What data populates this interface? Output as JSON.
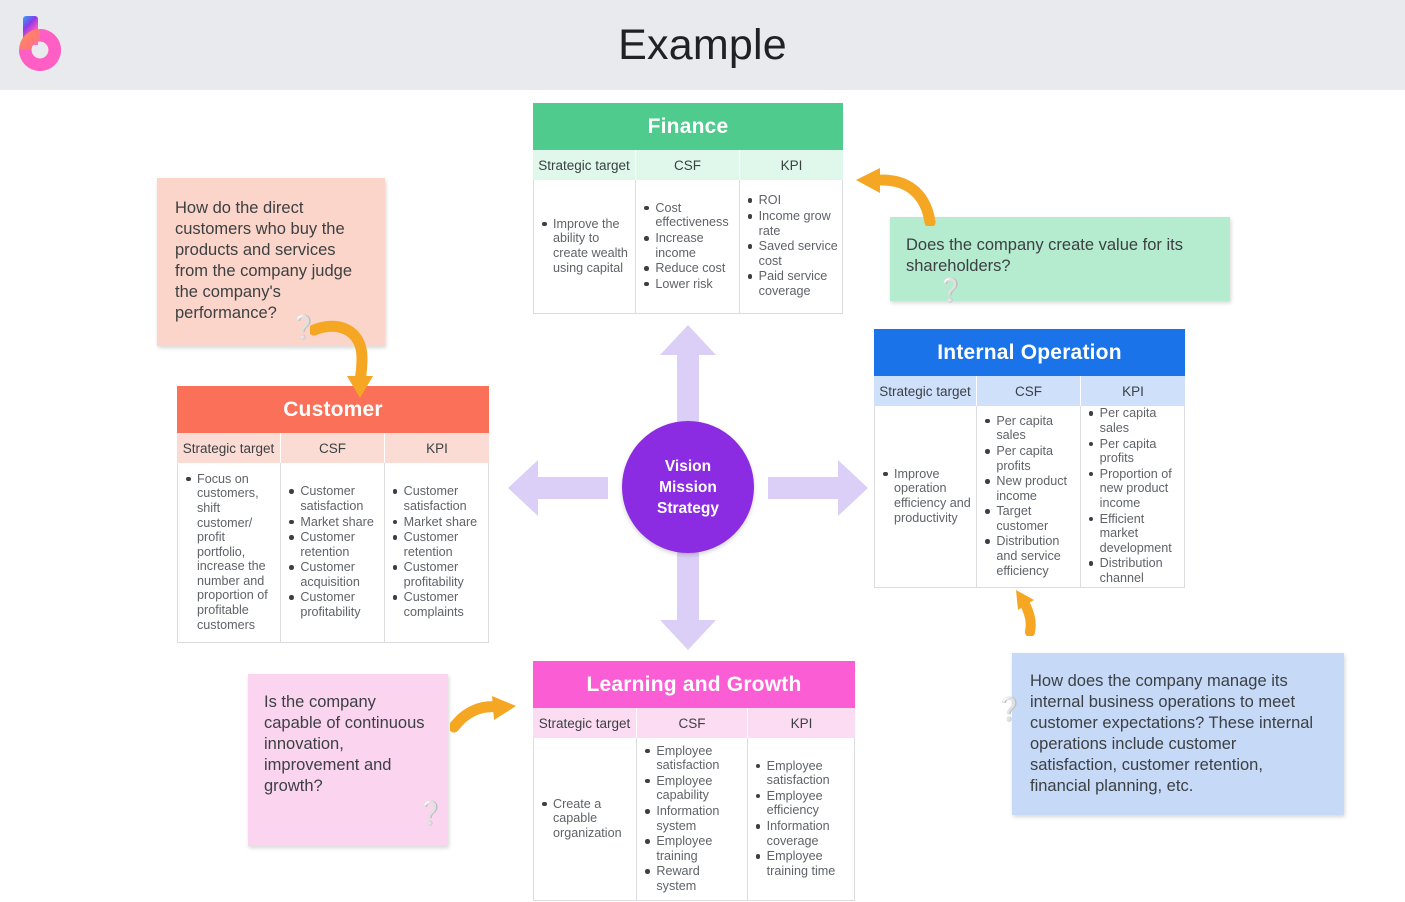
{
  "header": {
    "title": "Example",
    "logo_icon": "letter-b-logo",
    "background": "#e8eaed"
  },
  "center": {
    "lines": [
      "Vision",
      "Mission",
      "Strategy"
    ],
    "color": "#8b2be2",
    "arrow_color": "#dccff7",
    "arrows": [
      "arrow-up",
      "arrow-down",
      "arrow-left",
      "arrow-right"
    ]
  },
  "columns": [
    "Strategic target",
    "CSF",
    "KPI"
  ],
  "cards": {
    "finance": {
      "title": "Finance",
      "header_color": "#4ecb8d",
      "subhead_color": "#e0f7ec",
      "strategic_target": [
        "Improve the ability to create wealth using capital"
      ],
      "csf": [
        "Cost effectiveness",
        "Increase income",
        "Reduce cost",
        "Lower risk"
      ],
      "kpi": [
        "ROI",
        "Income grow rate",
        "Saved service cost",
        "Paid service coverage"
      ]
    },
    "customer": {
      "title": "Customer",
      "header_color": "#fa7058",
      "subhead_color": "#fbdcd4",
      "strategic_target": [
        "Focus on customers, shift customer/ profit portfolio, increase the number and proportion of profitable customers"
      ],
      "csf": [
        "Customer satisfaction",
        "Market share",
        "Customer retention",
        "Customer acquisition",
        "Customer profitability"
      ],
      "kpi": [
        "Customer satisfaction",
        "Market share",
        "Customer retention",
        "Customer profitability",
        "Customer complaints"
      ]
    },
    "internal_operation": {
      "title": "Internal Operation",
      "header_color": "#1a73e8",
      "subhead_color": "#cfe0fb",
      "strategic_target": [
        "Improve operation efficiency and productivity"
      ],
      "csf": [
        "Per capita sales",
        "Per capita profits",
        "New product income",
        "Target customer",
        "Distribution and service efficiency"
      ],
      "kpi": [
        "Per capita sales",
        "Per capita profits",
        "Proportion of new product income",
        "Efficient market development",
        "Distribution channel"
      ]
    },
    "learning_growth": {
      "title": "Learning and Growth",
      "header_color": "#fb5ed4",
      "subhead_color": "#fcdcf2",
      "strategic_target": [
        "Create a capable organization"
      ],
      "csf": [
        "Employee satisfaction",
        "Employee capability",
        "Information system",
        "Employee training",
        "Reward system"
      ],
      "kpi": [
        "Employee satisfaction",
        "Employee efficiency",
        "Information coverage",
        "Employee training time"
      ]
    }
  },
  "notes": {
    "customer": {
      "text": "How do the direct customers who buy the products and services from the company judge the company's performance?",
      "color": "#fbd5c9",
      "icon": "question-mark-emoji"
    },
    "finance": {
      "text": "Does the company create value for its shareholders?",
      "color": "#b5ebcf",
      "icon": "question-mark-emoji"
    },
    "learning_growth": {
      "text": "Is the company capable of continuous innovation, improvement and growth?",
      "color": "#fbd5f0",
      "icon": "question-mark-emoji"
    },
    "internal_operation": {
      "text": "How does the company manage its internal business operations to meet customer expectations? These internal operations include customer satisfaction, customer retention, financial planning, etc.",
      "color": "#c6d9f7",
      "icon": "question-mark-emoji"
    }
  },
  "doodles": {
    "color": "#f5a623",
    "items": [
      "curved-arrow-down",
      "curved-arrow-left",
      "curved-arrow-right",
      "curved-arrow-up-left"
    ]
  }
}
